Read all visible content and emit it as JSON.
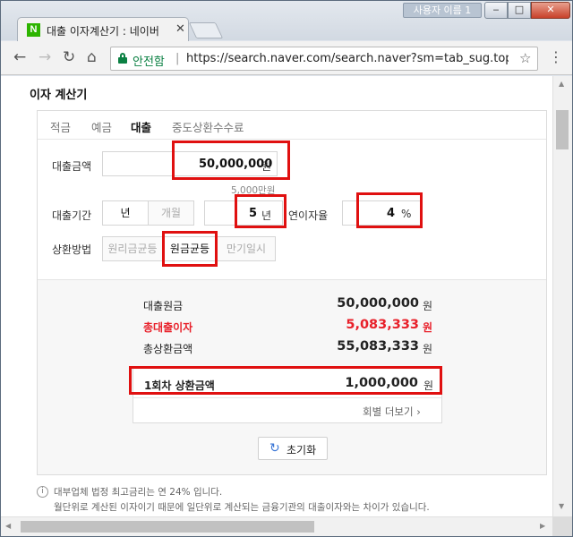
{
  "window": {
    "profile_label": "사용자 이름 1",
    "tab_title": "대출 이자계산기 : 네이버",
    "tab_favicon": "N"
  },
  "toolbar": {
    "secure_label": "안전함",
    "url": "https://search.naver.com/search.naver?sm=tab_sug.top&..."
  },
  "calculator": {
    "title": "이자 계산기",
    "tabs": [
      {
        "label": "적금",
        "active": false
      },
      {
        "label": "예금",
        "active": false
      },
      {
        "label": "대출",
        "active": true
      },
      {
        "label": "중도상환수수료",
        "active": false
      }
    ],
    "loan_amount": {
      "label": "대출금액",
      "value": "50,000,000",
      "unit": "원",
      "hint": "5,000만원"
    },
    "loan_period": {
      "label": "대출기간",
      "unit_year": "년",
      "unit_month": "개월",
      "value": "5",
      "unit": "년"
    },
    "interest_rate": {
      "label": "연이자율",
      "value": "4",
      "unit": "%"
    },
    "repayment": {
      "label": "상환방법",
      "options": [
        {
          "label": "원리금균등",
          "selected": false
        },
        {
          "label": "원금균등",
          "selected": true
        },
        {
          "label": "만기일시",
          "selected": false
        }
      ]
    },
    "summary": {
      "principal": {
        "label": "대출원금",
        "value": "50,000,000",
        "unit": "원"
      },
      "total_interest": {
        "label": "총대출이자",
        "value": "5,083,333",
        "unit": "원"
      },
      "total_repayment": {
        "label": "총상환금액",
        "value": "55,083,333",
        "unit": "원"
      },
      "first_payment": {
        "label": "1회차 상환금액",
        "value": "1,000,000",
        "unit": "원"
      },
      "more_label": "회별 더보기"
    },
    "reset_label": "초기화",
    "notes": [
      "대부업체 법정 최고금리는 연 24% 입니다.",
      "월단위로 계산된 이자이기 때문에 일단위로 계산되는 금융기관의 대출이자와는 차이가 있습니다."
    ]
  },
  "colors": {
    "accent_red": "#e8202a",
    "secure_green": "#0b8043",
    "naver_green": "#2db400",
    "highlight_box": "#e01010"
  }
}
